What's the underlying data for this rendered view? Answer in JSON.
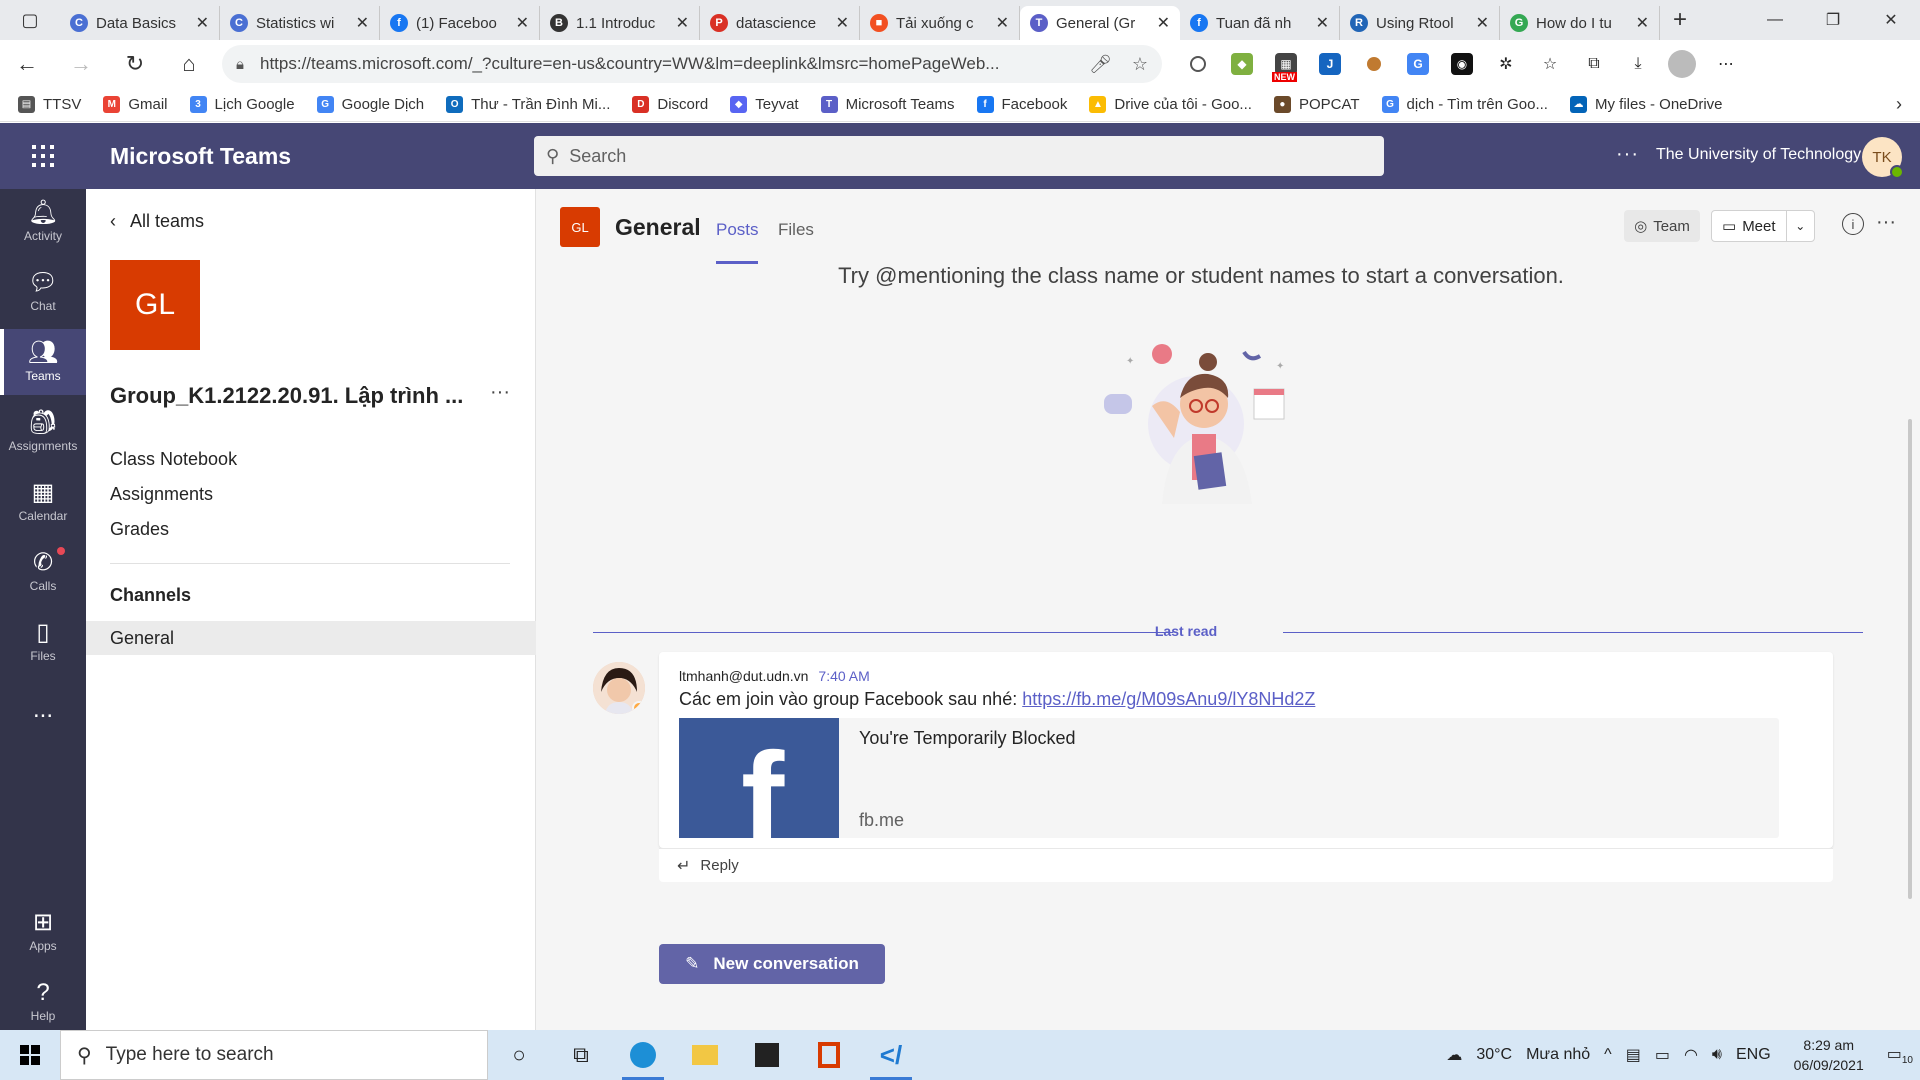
{
  "browser": {
    "tabs": [
      {
        "title": "Data Basics",
        "icon": "circle-c-icon",
        "color": "#4a6fd3"
      },
      {
        "title": "Statistics wi",
        "icon": "circle-c-icon",
        "color": "#4a6fd3"
      },
      {
        "title": "(1) Faceboo",
        "icon": "facebook-icon",
        "color": "#1877f2"
      },
      {
        "title": "1.1 Introduc",
        "icon": "book-icon",
        "color": "#333333"
      },
      {
        "title": "datascience",
        "icon": "pdf-icon",
        "color": "#d93025"
      },
      {
        "title": "Tải xuống c",
        "icon": "microsoft-icon",
        "color": "#f25022"
      },
      {
        "title": "General (Gr",
        "icon": "teams-icon",
        "color": "#5b5fc7",
        "active": true
      },
      {
        "title": "Tuan đã nh",
        "icon": "facebook-icon",
        "color": "#1877f2"
      },
      {
        "title": "Using Rtool",
        "icon": "r-icon",
        "color": "#2165b6"
      },
      {
        "title": "How do I tu",
        "icon": "translate-icon",
        "color": "#34a853"
      }
    ],
    "url": "https://teams.microsoft.com/_?culture=en-us&country=WW&lm=deeplink&lmsrc=homePageWeb...",
    "bookmarks": [
      {
        "label": "TTSV",
        "icon": "doc-icon",
        "color": "#555555"
      },
      {
        "label": "Gmail",
        "icon": "gmail-icon",
        "color": "#ea4335"
      },
      {
        "label": "Lịch Google",
        "icon": "calendar-icon",
        "color": "#4285f4"
      },
      {
        "label": "Google Dịch",
        "icon": "translate-icon",
        "color": "#4285f4"
      },
      {
        "label": "Thư - Trần Đình Mi...",
        "icon": "outlook-icon",
        "color": "#0f6cbd"
      },
      {
        "label": "Discord",
        "icon": "discord-icon",
        "color": "#d93025"
      },
      {
        "label": "Teyvat",
        "icon": "game-icon",
        "color": "#5865f2"
      },
      {
        "label": "Microsoft Teams",
        "icon": "teams-icon",
        "color": "#5b5fc7"
      },
      {
        "label": "Facebook",
        "icon": "facebook-icon",
        "color": "#1877f2"
      },
      {
        "label": "Drive của tôi - Goo...",
        "icon": "drive-icon",
        "color": "#fbbc04"
      },
      {
        "label": "POPCAT",
        "icon": "cat-icon",
        "color": "#6b4a2a"
      },
      {
        "label": "dịch - Tìm trên Goo...",
        "icon": "google-icon",
        "color": "#4285f4"
      },
      {
        "label": "My files - OneDrive",
        "icon": "onedrive-icon",
        "color": "#0364b8"
      }
    ],
    "new_badge": "NEW"
  },
  "teams": {
    "app_name": "Microsoft Teams",
    "search_placeholder": "Search",
    "org": "The University of Technology",
    "user_initials": "TK",
    "rail": [
      {
        "label": "Activity",
        "icon": "bell-icon"
      },
      {
        "label": "Chat",
        "icon": "chat-icon"
      },
      {
        "label": "Teams",
        "icon": "teams-icon",
        "active": true
      },
      {
        "label": "Assignments",
        "icon": "backpack-icon"
      },
      {
        "label": "Calendar",
        "icon": "calendar-icon"
      },
      {
        "label": "Calls",
        "icon": "phone-icon"
      },
      {
        "label": "Files",
        "icon": "file-icon"
      },
      {
        "label": "...",
        "icon": "more-icon"
      },
      {
        "label": "Apps",
        "icon": "apps-icon"
      },
      {
        "label": "Help",
        "icon": "help-icon"
      }
    ],
    "left": {
      "back": "All teams",
      "team_initials": "GL",
      "team_name": "Group_K1.2122.20.91. Lập trình ...",
      "links": [
        "Class Notebook",
        "Assignments",
        "Grades"
      ],
      "channels_heading": "Channels",
      "channel": "General"
    },
    "channel": {
      "initials": "GL",
      "title": "General",
      "tabs": [
        "Posts",
        "Files"
      ],
      "team_button": "Team",
      "meet_button": "Meet",
      "prompt": "Try @mentioning the class name or student names to start a conversation.",
      "last_read": "Last read",
      "message": {
        "author": "ltmhanh@dut.udn.vn",
        "time": "7:40 AM",
        "text": "Các em join vào group Facebook sau nhé: ",
        "link": "https://fb.me/g/M09sAnu9/lY8NHd2Z",
        "preview_title": "You're Temporarily Blocked",
        "preview_domain": "fb.me",
        "preview_letter": "f"
      },
      "reply": "Reply",
      "new_conversation": "New conversation"
    }
  },
  "taskbar": {
    "search_placeholder": "Type here to search",
    "weather": "30°C",
    "weather_desc": "Mưa nhỏ",
    "lang": "ENG",
    "time": "8:29 am",
    "date": "06/09/2021",
    "notif_count": "10"
  }
}
